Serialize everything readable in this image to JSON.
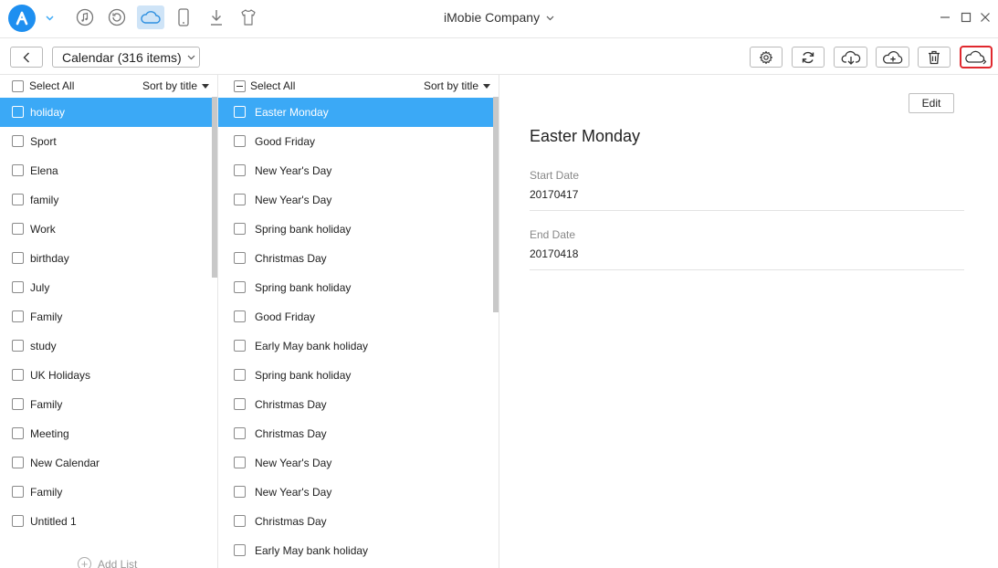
{
  "app": {
    "window_title": "iMobie Company",
    "nav_icons": [
      "music-icon",
      "history-icon",
      "icloud-icon",
      "phone-icon",
      "download-icon",
      "tshirt-icon"
    ],
    "active_nav": "icloud-icon",
    "accent_color": "#3ba9f6"
  },
  "toolbar": {
    "category_label": "Calendar (316 items)",
    "buttons": [
      "settings-icon",
      "refresh-icon",
      "cloud-download-icon",
      "cloud-upload-icon",
      "trash-icon",
      "cloud-switch-icon"
    ]
  },
  "calendars": {
    "select_all_label": "Select All",
    "sort_label": "Sort by title",
    "items": [
      "holiday",
      "Sport",
      "Elena",
      "family",
      "Work",
      "birthday",
      "July",
      "Family",
      "study",
      "UK Holidays",
      "Family",
      "Meeting",
      "New Calendar",
      "Family",
      "Untitled 1"
    ],
    "selected_index": 0,
    "add_list_label": "Add List"
  },
  "events": {
    "select_all_label": "Select All",
    "sort_label": "Sort by title",
    "items": [
      "Easter Monday",
      "Good Friday",
      "New Year's Day",
      "New Year's Day",
      "Spring bank holiday",
      "Christmas Day",
      "Spring bank holiday",
      "Good Friday",
      "Early May bank holiday",
      "Spring bank holiday",
      "Christmas Day",
      "Christmas Day",
      "New Year's Day",
      "New Year's Day",
      "Christmas Day",
      "Early May bank holiday"
    ],
    "selected_index": 0
  },
  "detail": {
    "edit_label": "Edit",
    "title": "Easter Monday",
    "start_label": "Start Date",
    "start_value": "20170417",
    "end_label": "End Date",
    "end_value": "20170418"
  }
}
